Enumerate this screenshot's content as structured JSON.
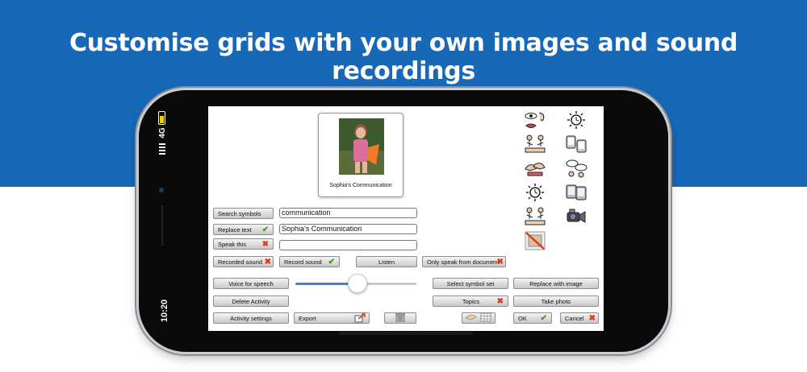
{
  "headline": "Customise grids with your own images and sound recordings",
  "status": {
    "time": "10:20",
    "network": "4G"
  },
  "colors": {
    "banner": "#1768b7",
    "accent": "#4a7fd0",
    "tick": "#3a9a1a",
    "cross": "#e03a1e"
  },
  "preview": {
    "caption": "Sophia's Communication"
  },
  "editor": {
    "search_symbols": "Search symbols",
    "replace_text": "Replace text",
    "speak_this": "Speak this",
    "search_value": "communication",
    "replace_value": "Sophia's Communication",
    "speak_value": "",
    "recorded_sound": "Recorded sound",
    "record_sound": "Record sound",
    "listen": "Listen",
    "only_speak": "Only speak from document",
    "voice_for_speech": "Voice for speech",
    "voice_level": 0.5,
    "select_symbol_set": "Select symbol set",
    "replace_with_image": "Replace with image",
    "delete_activity": "Delete Activity",
    "topics": "Topics",
    "take_photo": "Take photo",
    "activity_settings": "Activity settings",
    "export": "Export",
    "ok": "OK",
    "cancel": "Cancel"
  },
  "symbols": [
    "eye-ear-mouth-icon",
    "clock-icon",
    "people-talking-icon",
    "devices-icon",
    "hands-icon",
    "speech-bubbles-icon",
    "clock-icon",
    "tablets-icon",
    "people-talking-icon",
    "video-camera-icon",
    "no-image-icon"
  ]
}
